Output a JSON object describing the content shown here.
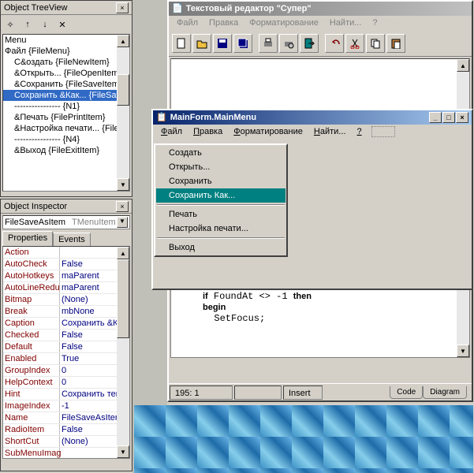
{
  "treeview": {
    "title": "Object TreeView",
    "items": [
      {
        "label": "Menu",
        "indent": 0
      },
      {
        "label": "Файл {FileMenu}",
        "indent": 0
      },
      {
        "label": "С&оздать {FileNewItem}",
        "indent": 1
      },
      {
        "label": "&Открыть... {FileOpenItem}",
        "indent": 1
      },
      {
        "label": "&Сохранить {FileSaveItem}",
        "indent": 1
      },
      {
        "label": "Сохранить &Как... {FileSaveAsI",
        "indent": 1,
        "selected": true
      },
      {
        "label": "---------------- {N1}",
        "indent": 1
      },
      {
        "label": "&Печать {FilePrintItem}",
        "indent": 1
      },
      {
        "label": "&Настройка печати... {FilePrintS",
        "indent": 1
      },
      {
        "label": "---------------- {N4}",
        "indent": 1
      },
      {
        "label": "&Выход {FileExitItem}",
        "indent": 1
      }
    ]
  },
  "inspector": {
    "title": "Object Inspector",
    "combo_value": "FileSaveAsItem",
    "combo_type": "TMenuItem",
    "tabs": {
      "properties": "Properties",
      "events": "Events"
    },
    "props": [
      {
        "name": "Action",
        "val": ""
      },
      {
        "name": "AutoCheck",
        "val": "False"
      },
      {
        "name": "AutoHotkeys",
        "val": "maParent"
      },
      {
        "name": "AutoLineRedu",
        "val": "maParent"
      },
      {
        "name": "Bitmap",
        "val": "(None)"
      },
      {
        "name": "Break",
        "val": "mbNone"
      },
      {
        "name": "Caption",
        "val": "Сохранить &Как."
      },
      {
        "name": "Checked",
        "val": "False"
      },
      {
        "name": "Default",
        "val": "False"
      },
      {
        "name": "Enabled",
        "val": "True"
      },
      {
        "name": "GroupIndex",
        "val": "0"
      },
      {
        "name": "HelpContext",
        "val": "0"
      },
      {
        "name": "Hint",
        "val": "Сохранить текущ"
      },
      {
        "name": "ImageIndex",
        "val": "-1"
      },
      {
        "name": "Name",
        "val": "FileSaveAsItem"
      },
      {
        "name": "RadioItem",
        "val": "False"
      },
      {
        "name": "ShortCut",
        "val": "(None)"
      },
      {
        "name": "SubMenuImag",
        "val": ""
      }
    ]
  },
  "editor": {
    "title": "Текстовый редактор \"Супер\"",
    "menu": [
      "Файл",
      "Правка",
      "Форматирование",
      "Найти...",
      "?"
    ],
    "code_lines": [
      "if FoundAt <> -1 then",
      "begin",
      "  SetFocus;"
    ],
    "status": {
      "pos": "195:  1",
      "mode": "Insert",
      "tab1": "Code",
      "tab2": "Diagram"
    }
  },
  "popup": {
    "title": "MainForm.MainMenu",
    "menu": [
      "Файл",
      "Правка",
      "Форматирование",
      "Найти...",
      "?"
    ],
    "dropdown": [
      {
        "label": "Создать"
      },
      {
        "label": "Открыть..."
      },
      {
        "label": "Сохранить"
      },
      {
        "label": "Сохранить Как...",
        "selected": true
      },
      {
        "sep": true
      },
      {
        "label": "Печать"
      },
      {
        "label": "Настройка печати..."
      },
      {
        "sep": true
      },
      {
        "label": "Выход"
      }
    ]
  }
}
